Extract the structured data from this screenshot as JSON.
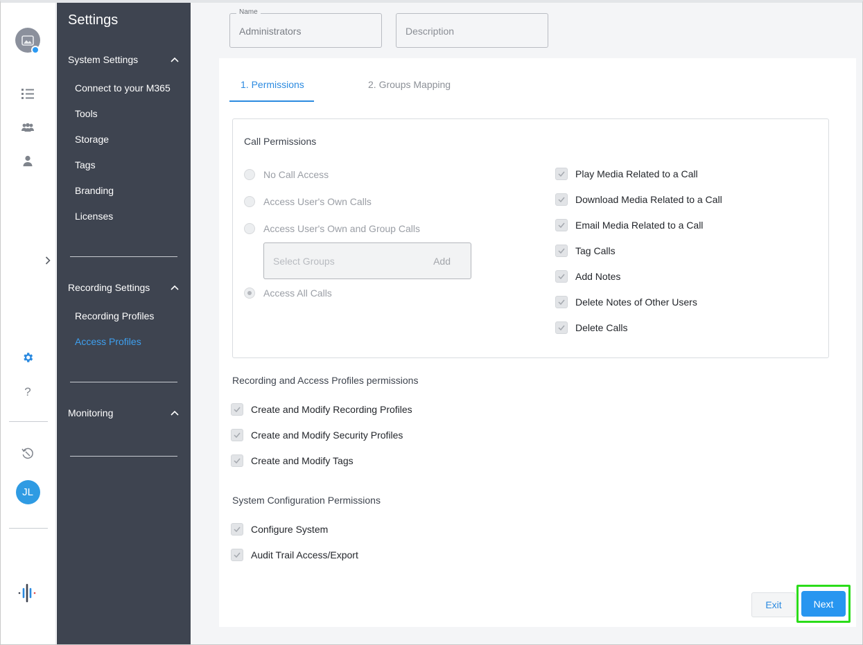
{
  "rail": {
    "avatar_initials": "JL",
    "icons": [
      "image-avatar-icon",
      "list-icon",
      "users-icon",
      "user-icon",
      "gear-icon",
      "help-icon",
      "history-icon",
      "logo-icon"
    ],
    "expander": "chevron-right-icon"
  },
  "sidebar": {
    "title": "Settings",
    "sections": [
      {
        "label": "System Settings",
        "items": [
          "Connect to your M365",
          "Tools",
          "Storage",
          "Tags",
          "Branding",
          "Licenses"
        ]
      },
      {
        "label": "Recording Settings",
        "items": [
          "Recording Profiles",
          "Access Profiles"
        ],
        "active_item": "Access Profiles"
      },
      {
        "label": "Monitoring",
        "items": []
      }
    ]
  },
  "form": {
    "name_label": "Name",
    "name_value": "Administrators",
    "description_placeholder": "Description"
  },
  "tabs": [
    "1. Permissions",
    "2. Groups Mapping"
  ],
  "call_permissions": {
    "title": "Call Permissions",
    "radios": [
      "No Call Access",
      "Access User's Own Calls",
      "Access User's Own and Group Calls",
      "Access All Calls"
    ],
    "selected_radio": "Access All Calls",
    "groups_placeholder": "Select Groups",
    "groups_add": "Add",
    "checkboxes": [
      "Play Media Related to a Call",
      "Download Media Related to a Call",
      "Email Media Related to a Call",
      "Tag Calls",
      "Add Notes",
      "Delete Notes of Other Users",
      "Delete Calls"
    ]
  },
  "profiles_permissions": {
    "title": "Recording and Access Profiles permissions",
    "checkboxes": [
      "Create and Modify Recording Profiles",
      "Create and Modify Security Profiles",
      "Create and Modify Tags"
    ]
  },
  "system_permissions": {
    "title": "System Configuration Permissions",
    "checkboxes": [
      "Configure System",
      "Audit Trail Access/Export"
    ]
  },
  "buttons": {
    "exit": "Exit",
    "next": "Next"
  },
  "colors": {
    "accent": "#2896f0",
    "sidebar": "#3e4450",
    "highlight": "#2bdc1a"
  }
}
